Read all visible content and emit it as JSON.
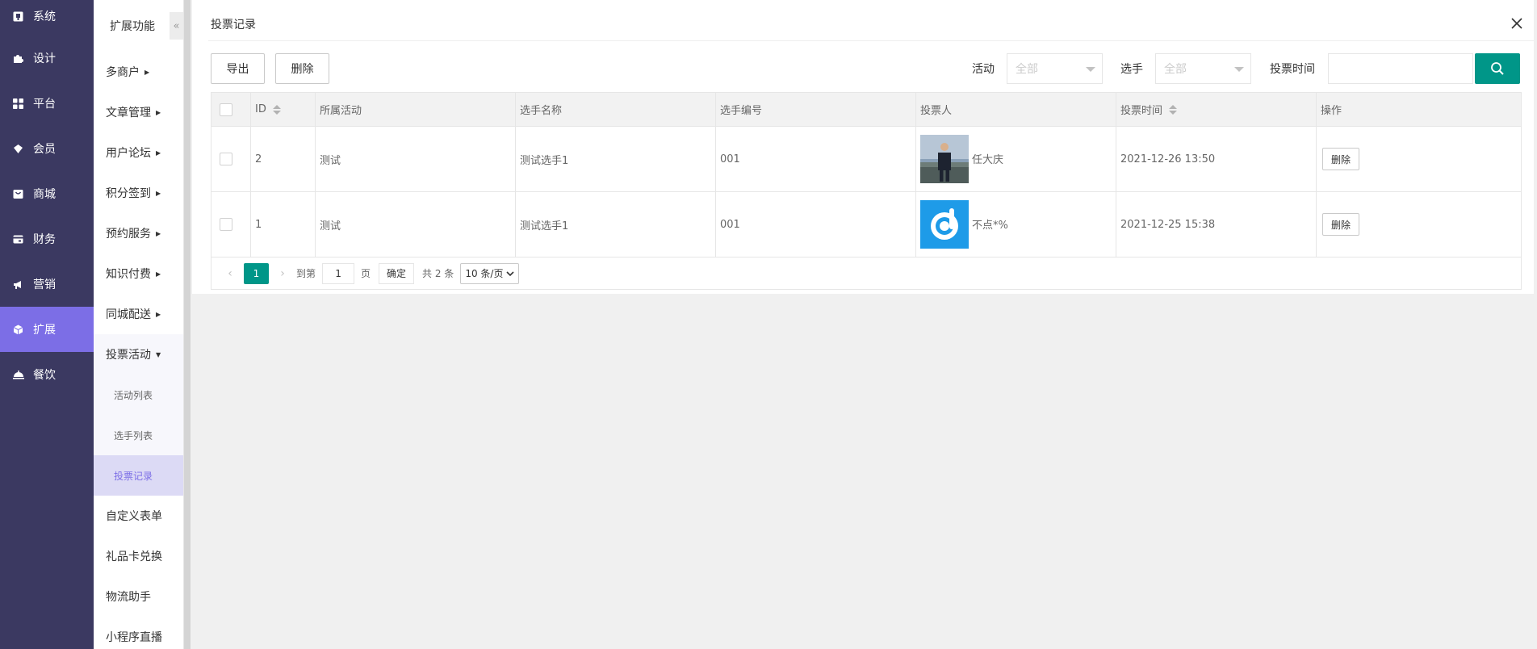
{
  "nav1": {
    "items": [
      {
        "label": "系统",
        "icon": "system-icon"
      },
      {
        "label": "设计",
        "icon": "puzzle-icon"
      },
      {
        "label": "平台",
        "icon": "grid-icon"
      },
      {
        "label": "会员",
        "icon": "member-icon"
      },
      {
        "label": "商城",
        "icon": "shop-icon"
      },
      {
        "label": "财务",
        "icon": "finance-icon"
      },
      {
        "label": "营销",
        "icon": "megaphone-icon"
      },
      {
        "label": "扩展",
        "icon": "cube-icon"
      },
      {
        "label": "餐饮",
        "icon": "dining-icon"
      }
    ]
  },
  "nav2": {
    "title": "扩展功能",
    "collapse_glyph": "«",
    "items": [
      "多商户",
      "文章管理",
      "用户论坛",
      "积分签到",
      "预约服务",
      "知识付费",
      "同城配送",
      "投票活动"
    ],
    "sub_items": [
      "活动列表",
      "选手列表",
      "投票记录"
    ],
    "items_after": [
      "自定义表单",
      "礼品卡兑换",
      "物流助手",
      "小程序直播"
    ]
  },
  "panel": {
    "title": "投票记录",
    "export_label": "导出",
    "delete_label": "删除",
    "filters": {
      "activity_label": "活动",
      "activity_value": "全部",
      "player_label": "选手",
      "player_value": "全部",
      "time_label": "投票时间",
      "time_value": ""
    }
  },
  "table": {
    "columns": [
      "ID",
      "所属活动",
      "选手名称",
      "选手编号",
      "投票人",
      "投票时间",
      "操作"
    ],
    "rows": [
      {
        "id": "2",
        "activity": "测试",
        "player": "测试选手1",
        "number": "001",
        "voter": "任大庆",
        "time": "2021-12-26 13:50",
        "action": "删除"
      },
      {
        "id": "1",
        "activity": "测试",
        "player": "测试选手1",
        "number": "001",
        "voter": "不点*%",
        "time": "2021-12-25 15:38",
        "action": "删除"
      }
    ]
  },
  "pager": {
    "prev": "‹",
    "current": "1",
    "next": "›",
    "goto_label": "到第",
    "goto_value": "1",
    "page_unit": "页",
    "confirm": "确定",
    "total": "共 2 条",
    "page_size": "10 条/页"
  },
  "colors": {
    "nav_bg": "#3b3961",
    "nav_active": "#7c6ee6",
    "primary": "#009688"
  }
}
